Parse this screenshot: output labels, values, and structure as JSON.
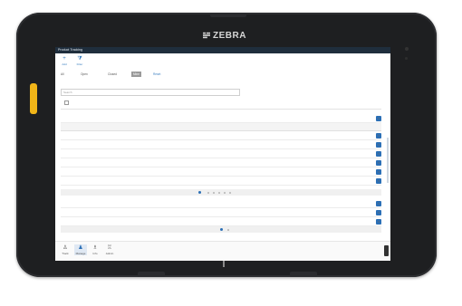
{
  "device": {
    "brand": "ZEBRA"
  },
  "app": {
    "title": "Product Tracking"
  },
  "toolbar": {
    "items": [
      {
        "label": "Add",
        "icon": "plus-icon"
      },
      {
        "label": "Filter",
        "icon": "filter-icon"
      }
    ]
  },
  "filters": {
    "chips": [
      "All",
      "Open",
      "Closed",
      "Mine",
      "Reset"
    ],
    "active_index": 3
  },
  "search": {
    "placeholder": "Search"
  },
  "bottom_nav": {
    "items": [
      {
        "label": "Track",
        "icon": "tracking-icon"
      },
      {
        "label": "Manage",
        "icon": "user-icon"
      },
      {
        "label": "Info",
        "icon": "info-icon"
      },
      {
        "label": "Admin",
        "icon": "admin-icon"
      }
    ],
    "active_index": 1
  }
}
